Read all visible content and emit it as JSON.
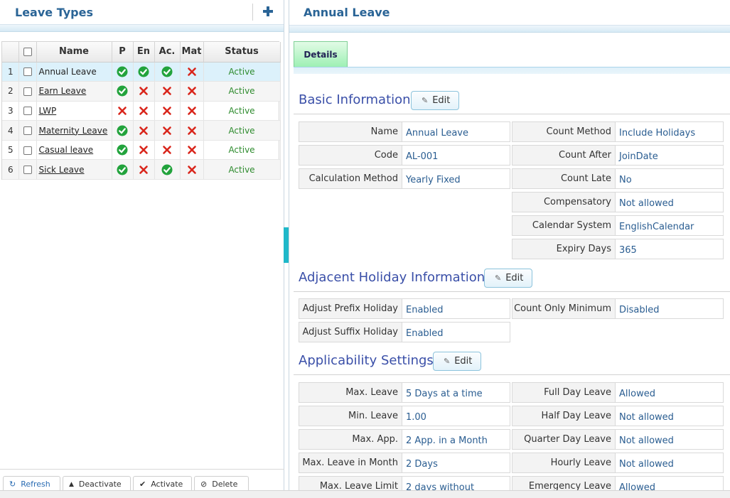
{
  "left_panel": {
    "title": "Leave Types",
    "columns": {
      "name": "Name",
      "p": "P",
      "en": "En",
      "ac": "Ac.",
      "mat": "Mat",
      "status": "Status"
    },
    "rows": [
      {
        "num": "1",
        "name": "Annual Leave",
        "p": true,
        "en": true,
        "ac": true,
        "mat": false,
        "status": "Active"
      },
      {
        "num": "2",
        "name": "Earn Leave",
        "p": true,
        "en": false,
        "ac": false,
        "mat": false,
        "status": "Active"
      },
      {
        "num": "3",
        "name": "LWP",
        "p": false,
        "en": false,
        "ac": false,
        "mat": false,
        "status": "Active"
      },
      {
        "num": "4",
        "name": "Maternity Leave",
        "p": true,
        "en": false,
        "ac": false,
        "mat": false,
        "status": "Active"
      },
      {
        "num": "5",
        "name": "Casual leave",
        "p": true,
        "en": false,
        "ac": false,
        "mat": false,
        "status": "Active"
      },
      {
        "num": "6",
        "name": "Sick Leave",
        "p": true,
        "en": false,
        "ac": true,
        "mat": false,
        "status": "Active"
      }
    ],
    "footer": {
      "refresh": "Refresh",
      "deactivate": "Deactivate",
      "activate": "Activate",
      "delete": "Delete"
    }
  },
  "right_panel": {
    "title": "Annual Leave",
    "tab": "Details",
    "edit_label": "Edit",
    "basic": {
      "title": "Basic Information",
      "left": [
        {
          "label": "Name",
          "value": "Annual Leave"
        },
        {
          "label": "Code",
          "value": "AL-001"
        },
        {
          "label": "Calculation Method",
          "value": "Yearly Fixed"
        }
      ],
      "right": [
        {
          "label": "Count Method",
          "value": "Include Holidays"
        },
        {
          "label": "Count After",
          "value": "JoinDate"
        },
        {
          "label": "Count Late",
          "value": "No"
        },
        {
          "label": "Compensatory",
          "value": "Not allowed"
        },
        {
          "label": "Calendar System",
          "value": "EnglishCalendar"
        },
        {
          "label": "Expiry Days",
          "value": "365"
        }
      ]
    },
    "adjacent": {
      "title": "Adjacent Holiday Information",
      "left": [
        {
          "label": "Adjust Prefix Holiday",
          "value": "Enabled"
        },
        {
          "label": "Adjust Suffix Holiday",
          "value": "Enabled"
        }
      ],
      "right": [
        {
          "label": "Count Only Minimum",
          "value": "Disabled"
        }
      ]
    },
    "applicability": {
      "title": "Applicability Settings",
      "left": [
        {
          "label": "Max. Leave",
          "value": "5 Days at a time"
        },
        {
          "label": "Min. Leave",
          "value": "1.00"
        },
        {
          "label": "Max. App.",
          "value": "2 App. in a Month"
        },
        {
          "label": "Max. Leave in Month",
          "value": "2 Days"
        },
        {
          "label": "Max. Leave Limit",
          "value": "2 days without"
        }
      ],
      "right": [
        {
          "label": "Full Day Leave",
          "value": "Allowed"
        },
        {
          "label": "Half Day Leave",
          "value": "Not allowed"
        },
        {
          "label": "Quarter Day Leave",
          "value": "Not allowed"
        },
        {
          "label": "Hourly Leave",
          "value": "Not allowed"
        },
        {
          "label": "Emergency Leave",
          "value": "Allowed"
        }
      ]
    }
  },
  "colors": {
    "accent": "#2a6496",
    "section": "#3a4fa8",
    "active": "#2e8b2e",
    "check": "#22a33c",
    "cross": "#d9261c"
  },
  "icons": {
    "add": "plus-icon",
    "yes": "check-circle-icon",
    "no": "cross-icon",
    "refresh": "refresh-icon",
    "deactivate": "chevron-up-icon",
    "activate": "checkmark-icon",
    "delete": "ban-icon",
    "edit": "pencil-icon"
  }
}
